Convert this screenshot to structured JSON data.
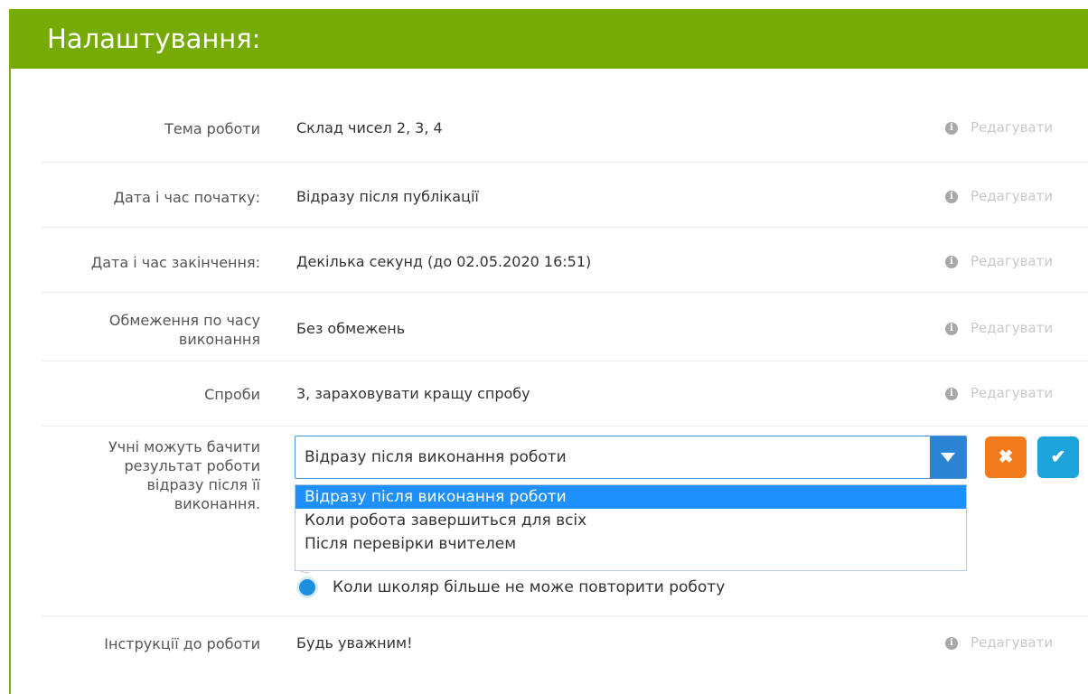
{
  "header": {
    "title": "Налаштування:"
  },
  "rows": [
    {
      "label": "Тема роботи",
      "value": "Склад чисел 2, 3, 4",
      "edit": "Редагувати"
    },
    {
      "label": "Дата і час початку:",
      "value": "Відразу після публікації",
      "edit": "Редагувати"
    },
    {
      "label": "Дата і час закінчення:",
      "value": "Декілька секунд (до 02.05.2020 16:51)",
      "edit": "Редагувати"
    },
    {
      "label_line1": "Обмеження по часу",
      "label_line2": "виконання",
      "value": "Без обмежень",
      "edit": "Редагувати"
    },
    {
      "label": "Спроби",
      "value": "3, зараховувати кращу спробу",
      "edit": "Редагувати"
    },
    {
      "label_line1": "Учні можуть бачити",
      "label_line2": "результат роботи",
      "label_line3": "відразу після її",
      "label_line4": "виконання."
    },
    {
      "label": "Інструкції до роботи",
      "value": "Будь уважним!",
      "edit": "Редагувати"
    }
  ],
  "info_glyph": "i",
  "select": {
    "value": "Відразу після виконання роботи",
    "options": [
      "Відразу після виконання роботи",
      "Коли робота завершиться для всіх",
      "Після перевірки вчителем"
    ]
  },
  "radio": {
    "label": "Коли школяр більше не може повторити роботу"
  },
  "buttons": {
    "cancel": "✖",
    "confirm": "✔"
  },
  "colors": {
    "header": "#76ab06",
    "accent": "#1e90ff",
    "cancel": "#f07a1c",
    "confirm": "#1ca3dc"
  }
}
